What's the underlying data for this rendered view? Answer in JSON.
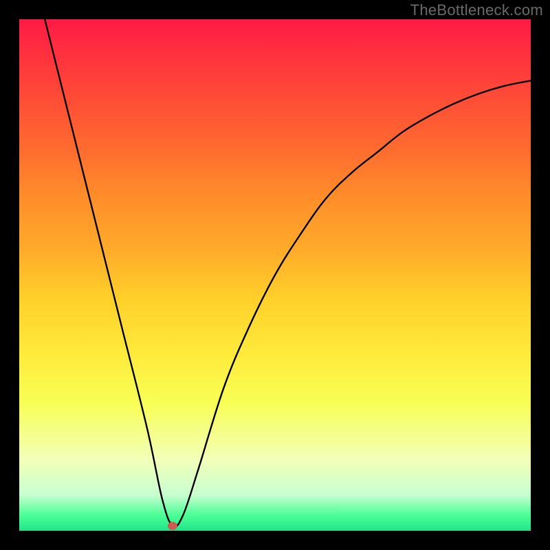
{
  "watermark": "TheBottleneck.com",
  "chart_data": {
    "type": "line",
    "title": "",
    "xlabel": "",
    "ylabel": "",
    "xlim": [
      0,
      100
    ],
    "ylim": [
      0,
      100
    ],
    "grid": false,
    "legend": false,
    "series": [
      {
        "name": "bottleneck-curve",
        "x": [
          5,
          10,
          15,
          20,
          25,
          28,
          30,
          32,
          35,
          40,
          45,
          50,
          55,
          60,
          65,
          70,
          75,
          80,
          85,
          90,
          95,
          100
        ],
        "y": [
          100,
          80,
          60,
          40,
          20,
          6,
          1,
          3,
          12,
          28,
          40,
          50,
          58,
          65,
          70,
          74,
          78,
          81,
          83.5,
          85.5,
          87,
          88
        ]
      }
    ],
    "marker": {
      "x": 30,
      "y": 1,
      "color": "#cf5a51"
    },
    "background_gradient": {
      "top": "#ff1a45",
      "bottom": "#22e38a"
    }
  }
}
